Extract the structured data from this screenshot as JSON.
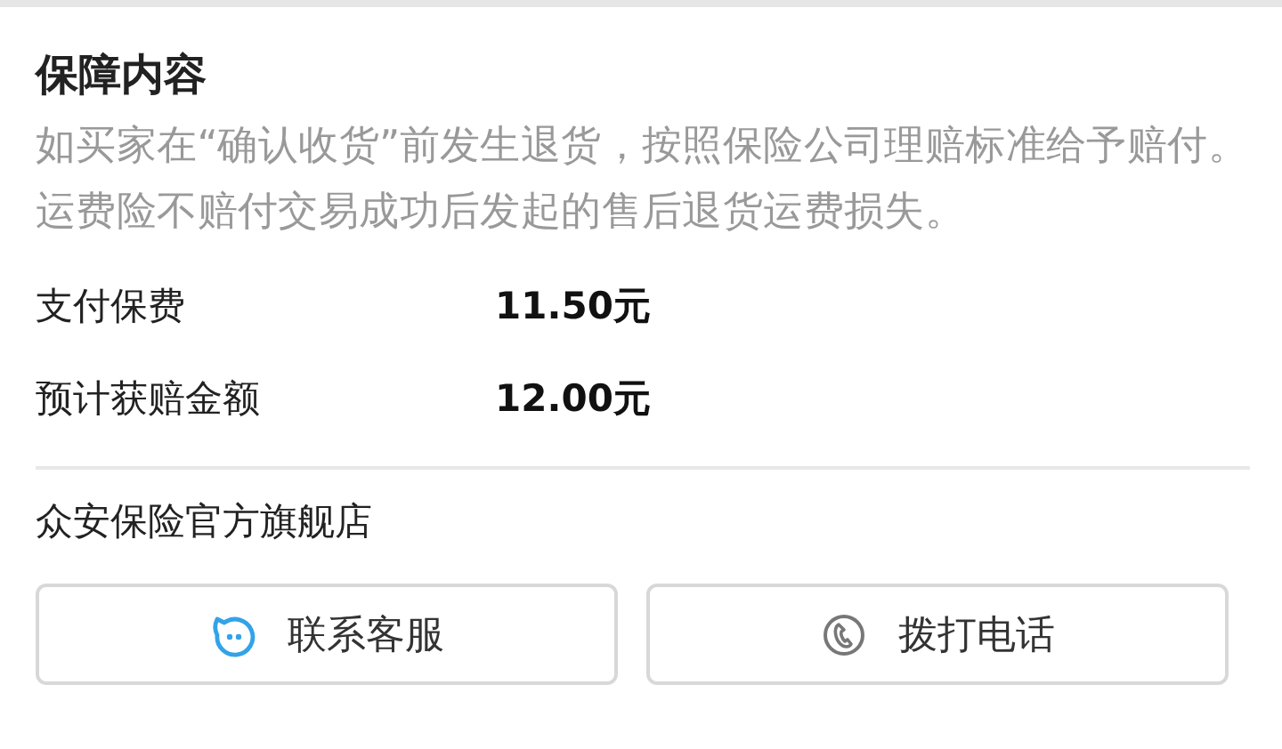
{
  "section_title": "保障内容",
  "description": "如买家在“确认收货”前发生退货，按照保险公司理赔标准给予赔付。运费险不赔付交易成功后发起的售后退货运费损失。",
  "details": [
    {
      "label": "支付保费",
      "value": "11.50元"
    },
    {
      "label": "预计获赔金额",
      "value": "12.00元"
    }
  ],
  "store_name": "众安保险官方旗舰店",
  "buttons": [
    {
      "kind": "chat",
      "label": "联系客服"
    },
    {
      "kind": "phone",
      "label": "拨打电话"
    }
  ]
}
